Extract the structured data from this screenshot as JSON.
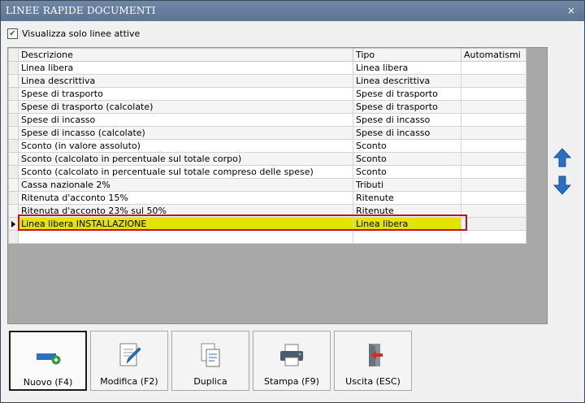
{
  "window": {
    "title": "LINEE RAPIDE DOCUMENTI",
    "close_glyph": "×"
  },
  "filter": {
    "label": "Visualizza solo linee attive",
    "checked": true
  },
  "grid": {
    "columns": [
      "Descrizione",
      "Tipo",
      "Automatismi"
    ],
    "rows": [
      {
        "descrizione": "Linea libera",
        "tipo": "Linea libera",
        "automatismi": ""
      },
      {
        "descrizione": "Linea descrittiva",
        "tipo": "Linea descrittiva",
        "automatismi": ""
      },
      {
        "descrizione": "Spese di trasporto",
        "tipo": "Spese di trasporto",
        "automatismi": ""
      },
      {
        "descrizione": "Spese di trasporto (calcolate)",
        "tipo": "Spese di trasporto",
        "automatismi": ""
      },
      {
        "descrizione": "Spese di incasso",
        "tipo": "Spese di incasso",
        "automatismi": ""
      },
      {
        "descrizione": "Spese di incasso (calcolate)",
        "tipo": "Spese di incasso",
        "automatismi": ""
      },
      {
        "descrizione": "Sconto (in valore assoluto)",
        "tipo": "Sconto",
        "automatismi": ""
      },
      {
        "descrizione": "Sconto (calcolato in percentuale sul totale corpo)",
        "tipo": "Sconto",
        "automatismi": ""
      },
      {
        "descrizione": "Sconto (calcolato in percentuale sul totale compreso delle spese)",
        "tipo": "Sconto",
        "automatismi": ""
      },
      {
        "descrizione": "Cassa nazionale 2%",
        "tipo": "Tributi",
        "automatismi": ""
      },
      {
        "descrizione": "Ritenuta d'acconto 15%",
        "tipo": "Ritenute",
        "automatismi": ""
      },
      {
        "descrizione": "Ritenuta d'acconto 23% sul 50%",
        "tipo": "Ritenute",
        "automatismi": ""
      },
      {
        "descrizione": "Linea libera INSTALLAZIONE",
        "tipo": "Linea libera",
        "automatismi": ""
      }
    ],
    "current_row_index": 12,
    "highlight_color": "#e3e300"
  },
  "side_buttons": [
    {
      "name": "move-up-button",
      "icon": "arrow-up-icon"
    },
    {
      "name": "move-down-button",
      "icon": "arrow-down-icon"
    }
  ],
  "buttons": {
    "nuovo": "Nuovo (F4)",
    "modifica": "Modifica (F2)",
    "duplica": "Duplica",
    "stampa": "Stampa (F9)",
    "uscita": "Uscita (ESC)"
  },
  "colors": {
    "titlebar": "#627995",
    "accent_blue": "#2a6fc2",
    "red_border": "#c0121a"
  }
}
